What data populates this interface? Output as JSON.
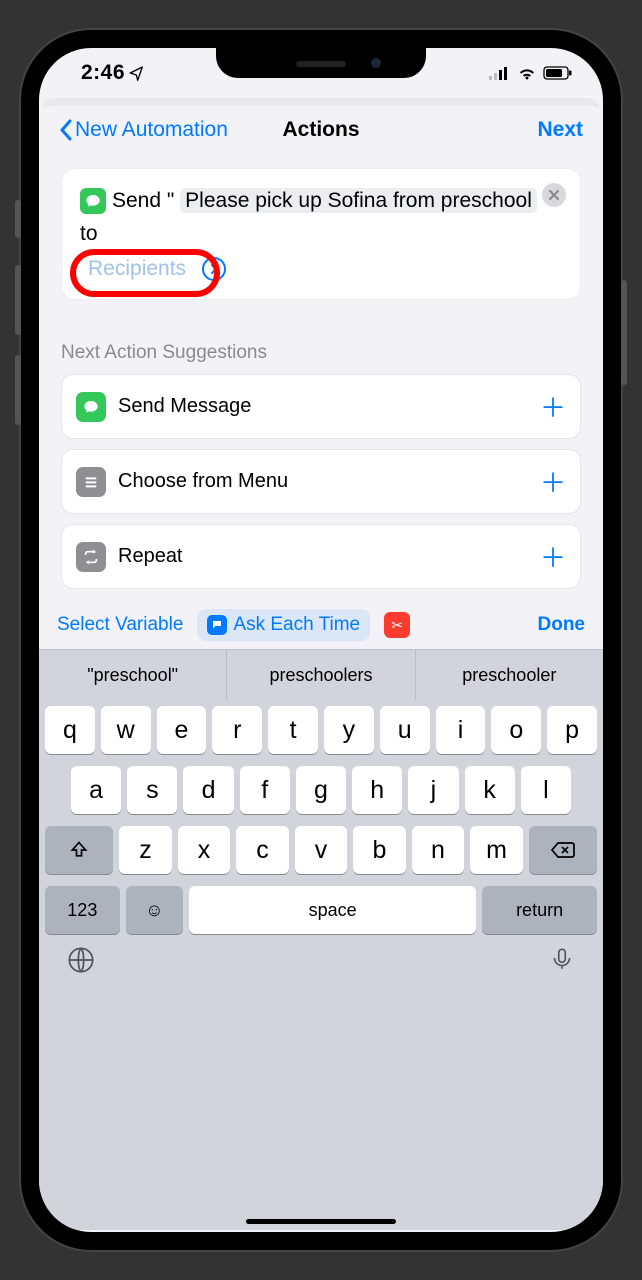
{
  "status": {
    "time": "2:46",
    "location_glyph": "➤"
  },
  "nav": {
    "back": "New Automation",
    "title": "Actions",
    "next": "Next"
  },
  "action": {
    "prefix": "Send \" ",
    "message": "Please pick up Sofina from preschool",
    "mid": " \" to",
    "recipients_placeholder": "Recipients"
  },
  "suggestions": {
    "header": "Next Action Suggestions",
    "items": [
      {
        "label": "Send Message",
        "icon_color": "#34c759",
        "icon_kind": "message"
      },
      {
        "label": "Choose from Menu",
        "icon_color": "#8e8e93",
        "icon_kind": "menu"
      },
      {
        "label": "Repeat",
        "icon_color": "#8e8e93",
        "icon_kind": "repeat"
      }
    ]
  },
  "varbar": {
    "select": "Select Variable",
    "ask": "Ask Each Time",
    "done": "Done"
  },
  "keyboard": {
    "predictions": [
      "\"preschool\"",
      "preschoolers",
      "preschooler"
    ],
    "row1": [
      "q",
      "w",
      "e",
      "r",
      "t",
      "y",
      "u",
      "i",
      "o",
      "p"
    ],
    "row2": [
      "a",
      "s",
      "d",
      "f",
      "g",
      "h",
      "j",
      "k",
      "l"
    ],
    "row3": [
      "z",
      "x",
      "c",
      "v",
      "b",
      "n",
      "m"
    ],
    "numKey": "123",
    "space": "space",
    "return": "return"
  }
}
